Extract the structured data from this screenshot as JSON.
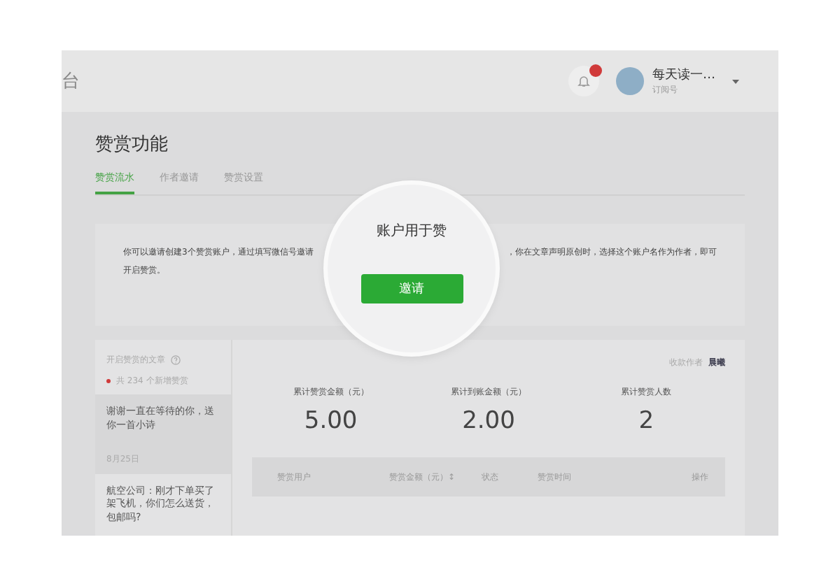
{
  "header": {
    "brand": "台",
    "account": {
      "name": "每天读一…",
      "type": "订阅号"
    }
  },
  "page": {
    "title": "赞赏功能"
  },
  "tabs": [
    {
      "label": "赞赏流水",
      "selected": true
    },
    {
      "label": "作者邀请",
      "selected": false
    },
    {
      "label": "赞赏设置",
      "selected": false
    }
  ],
  "notice": {
    "left": "你可以邀请创建3个赞赏账户，通过填写微信号邀请",
    "right": "，你在文章声明原创时，选择这个账户名作为作者，即可",
    "line2": "开启赞赏。"
  },
  "magnifier": {
    "text": "账户用于赞",
    "button": "邀请"
  },
  "sidebar": {
    "heading": "开启赞赏的文章",
    "summary": "共 234 个新增赞赏",
    "items": [
      {
        "title": "谢谢一直在等待的你，送你一首小诗",
        "date": "8月25日",
        "selected": true
      },
      {
        "title": "航空公司：刚才下单买了架飞机，你们怎么送货，包邮吗?",
        "selected": false
      }
    ]
  },
  "payee": {
    "label": "收款作者",
    "name": "晨曦"
  },
  "stats": [
    {
      "label": "累计赞赏金额（元）",
      "value": "5.00"
    },
    {
      "label": "累计到账金额（元）",
      "value": "2.00"
    },
    {
      "label": "累计赞赏人数",
      "value": "2"
    }
  ],
  "table": {
    "columns": [
      "赞赏用户",
      "赞赏金额（元）↕",
      "状态",
      "赞赏时间",
      "操作"
    ]
  }
}
